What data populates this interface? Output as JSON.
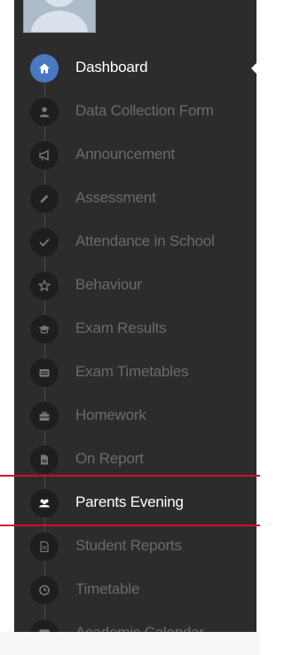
{
  "sidebar": {
    "items": [
      {
        "label": "Dashboard",
        "icon": "home-icon",
        "state": "active"
      },
      {
        "label": "Data Collection Form",
        "icon": "user-icon",
        "state": "normal"
      },
      {
        "label": "Announcement",
        "icon": "bullhorn-icon",
        "state": "normal"
      },
      {
        "label": "Assessment",
        "icon": "pencil-icon",
        "state": "normal"
      },
      {
        "label": "Attendance in School",
        "icon": "check-icon",
        "state": "normal"
      },
      {
        "label": "Behaviour",
        "icon": "star-icon",
        "state": "normal"
      },
      {
        "label": "Exam Results",
        "icon": "graduation-cap-icon",
        "state": "normal"
      },
      {
        "label": "Exam Timetables",
        "icon": "card-icon",
        "state": "normal"
      },
      {
        "label": "Homework",
        "icon": "briefcase-icon",
        "state": "normal"
      },
      {
        "label": "On Report",
        "icon": "document-icon",
        "state": "normal"
      },
      {
        "label": "Parents Evening",
        "icon": "users-icon",
        "state": "highlighted"
      },
      {
        "label": "Student Reports",
        "icon": "file-text-icon",
        "state": "normal"
      },
      {
        "label": "Timetable",
        "icon": "clock-icon",
        "state": "normal"
      },
      {
        "label": "Academic Calendar",
        "icon": "calendar-icon",
        "state": "normal"
      }
    ]
  },
  "colors": {
    "sidebar_bg": "#2c2c2c",
    "active_icon_bg": "#4a79c2",
    "highlight_line": "#d40b2f",
    "inactive_text": "#6a6a6a",
    "active_text": "#ffffff"
  }
}
